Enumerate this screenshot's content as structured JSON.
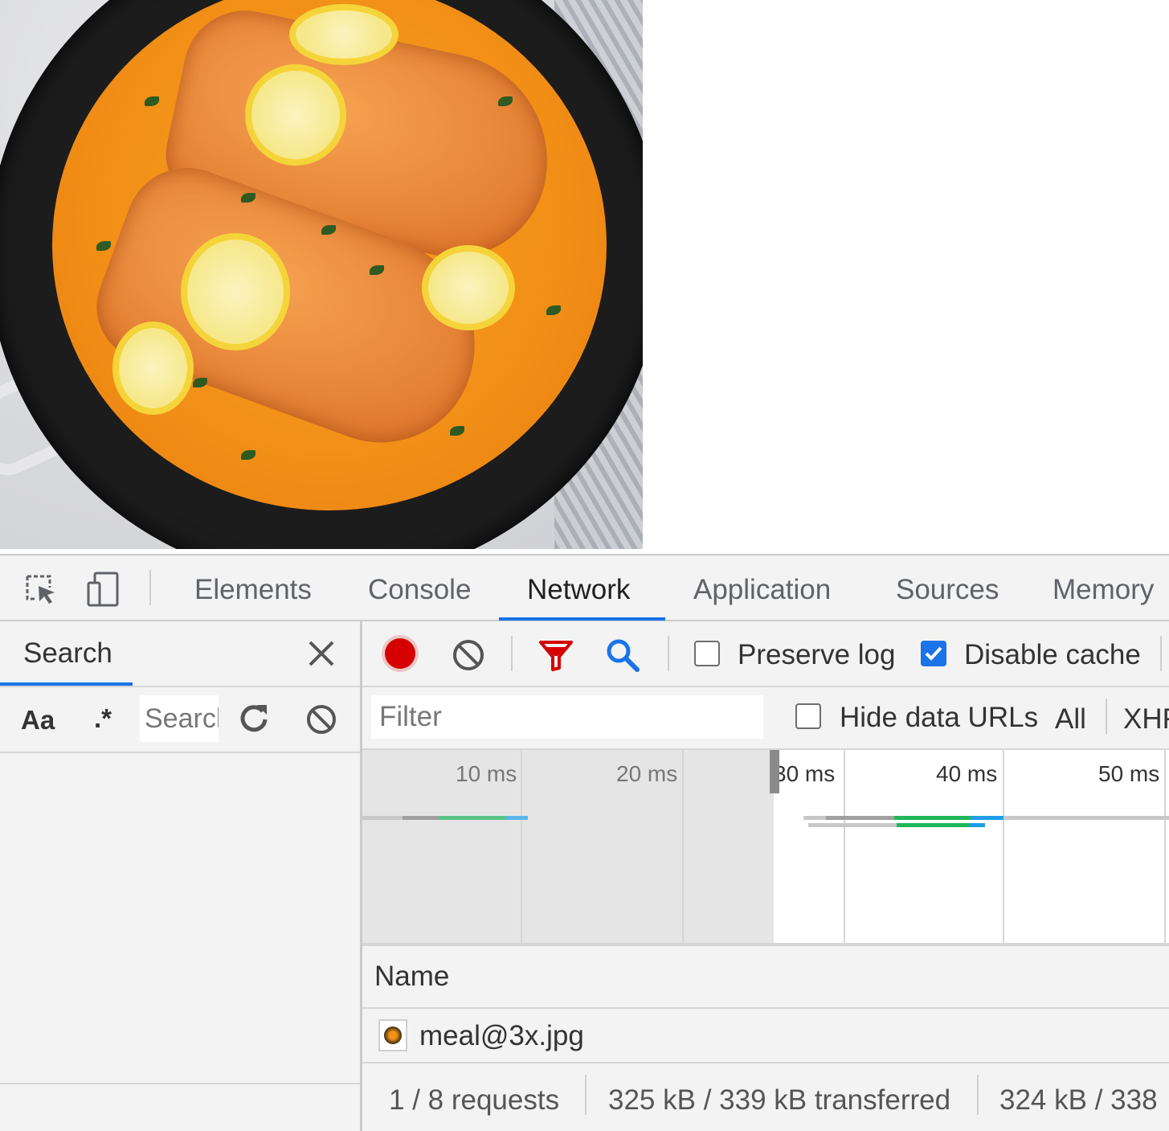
{
  "page": {
    "image_alt": "meal@3x.jpg"
  },
  "devtools": {
    "tabs": [
      {
        "label": "Elements"
      },
      {
        "label": "Console"
      },
      {
        "label": "Network",
        "active": true
      },
      {
        "label": "Application"
      },
      {
        "label": "Sources"
      },
      {
        "label": "Memory"
      }
    ],
    "search": {
      "title": "Search",
      "case_toggle": "Aa",
      "regex_toggle": ".*",
      "placeholder": "Search"
    },
    "network": {
      "preserve_log_label": "Preserve log",
      "preserve_log_checked": false,
      "disable_cache_label": "Disable cache",
      "disable_cache_checked": true,
      "filter_placeholder": "Filter",
      "hide_data_urls_label": "Hide data URLs",
      "hide_data_urls_checked": false,
      "type_filters": [
        "All",
        "XHR"
      ],
      "timeline_ticks": [
        "10 ms",
        "20 ms",
        "30 ms",
        "40 ms",
        "50 ms"
      ],
      "name_header": "Name",
      "requests": [
        {
          "name": "meal@3x.jpg"
        }
      ],
      "status": {
        "requests": "1 / 8 requests",
        "transferred": "325 kB / 339 kB transferred",
        "resources": "324 kB / 338"
      }
    },
    "colors": {
      "accent": "#1a73e8",
      "record": "#d50000",
      "filter_icon": "#d50000",
      "timing_waiting": "#1eb859",
      "timing_download": "#1e9ee8",
      "timing_queue": "#a0a0a0"
    }
  }
}
